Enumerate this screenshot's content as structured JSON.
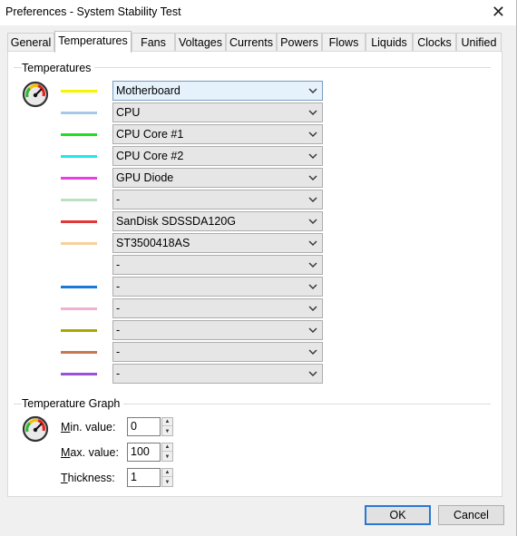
{
  "window": {
    "title": "Preferences - System Stability Test",
    "close_glyph": "✕"
  },
  "tabs": [
    {
      "label": "General"
    },
    {
      "label": "Temperatures",
      "active": true
    },
    {
      "label": "Fans"
    },
    {
      "label": "Voltages"
    },
    {
      "label": "Currents"
    },
    {
      "label": "Powers"
    },
    {
      "label": "Flows"
    },
    {
      "label": "Liquids"
    },
    {
      "label": "Clocks"
    },
    {
      "label": "Unified"
    }
  ],
  "temperatures": {
    "section_label": "Temperatures",
    "icon": "gauge-icon",
    "rows": [
      {
        "color": "#f5f500",
        "value": "Motherboard"
      },
      {
        "color": "#a8c8e8",
        "value": "CPU"
      },
      {
        "color": "#1fe01f",
        "value": "CPU Core #1"
      },
      {
        "color": "#1fe8e8",
        "value": "CPU Core #2"
      },
      {
        "color": "#e83ee8",
        "value": "GPU Diode"
      },
      {
        "color": "#bfe0c0",
        "value": "-"
      },
      {
        "color": "#e03838",
        "value": "SanDisk SDSSDA120G"
      },
      {
        "color": "#f8d09a",
        "value": "ST3500418AS"
      },
      {
        "color": "#ffffff",
        "value": "-"
      },
      {
        "color": "#1a78d8",
        "value": "-"
      },
      {
        "color": "#f4b0d0",
        "value": "-"
      },
      {
        "color": "#a8a800",
        "value": "-"
      },
      {
        "color": "#c87850",
        "value": "-"
      },
      {
        "color": "#9a50d8",
        "value": "-"
      }
    ]
  },
  "graph": {
    "section_label": "Temperature Graph",
    "icon": "gauge-icon",
    "min": {
      "label_key": "M",
      "label_rest": "in. value:",
      "value": "0"
    },
    "max": {
      "label_key": "M",
      "label_rest": "ax. value:",
      "value": "100"
    },
    "thickness": {
      "label_key": "T",
      "label_rest": "hickness:",
      "value": "1"
    }
  },
  "buttons": {
    "ok": "OK",
    "cancel": "Cancel"
  }
}
